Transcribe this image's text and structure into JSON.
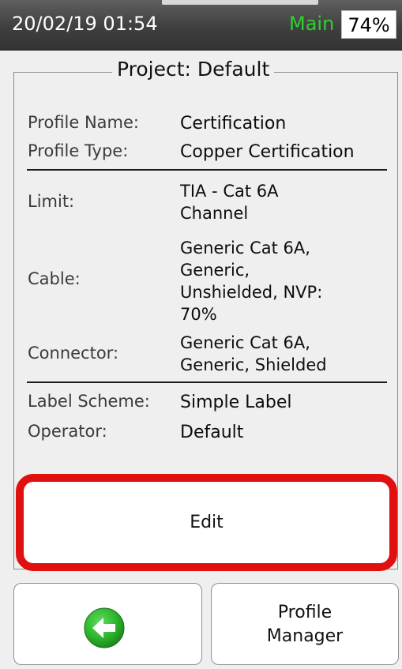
{
  "status": {
    "datetime": "20/02/19 01:54",
    "mode": "Main",
    "battery": "74%"
  },
  "project": {
    "title": "Project: Default"
  },
  "profile": {
    "name_label": "Profile Name:",
    "name_value": "Certification",
    "type_label": "Profile Type:",
    "type_value": "Copper Certification"
  },
  "limit": {
    "label": "Limit:",
    "value": "TIA - Cat 6A\nChannel"
  },
  "cable": {
    "label": "Cable:",
    "value": "Generic Cat 6A,\nGeneric,\nUnshielded, NVP:\n70%"
  },
  "connector": {
    "label": "Connector:",
    "value": "Generic Cat 6A,\nGeneric, Shielded"
  },
  "label_scheme": {
    "label": "Label Scheme:",
    "value": "Simple Label"
  },
  "operator": {
    "label": "Operator:",
    "value": "Default"
  },
  "buttons": {
    "edit": "Edit",
    "profile_manager": "Profile\nManager",
    "back_icon": "back-arrow-icon"
  },
  "colors": {
    "edit_highlight": "#e01010",
    "mode_text": "#2ed12e",
    "back_icon_green": "#2bb52b"
  }
}
